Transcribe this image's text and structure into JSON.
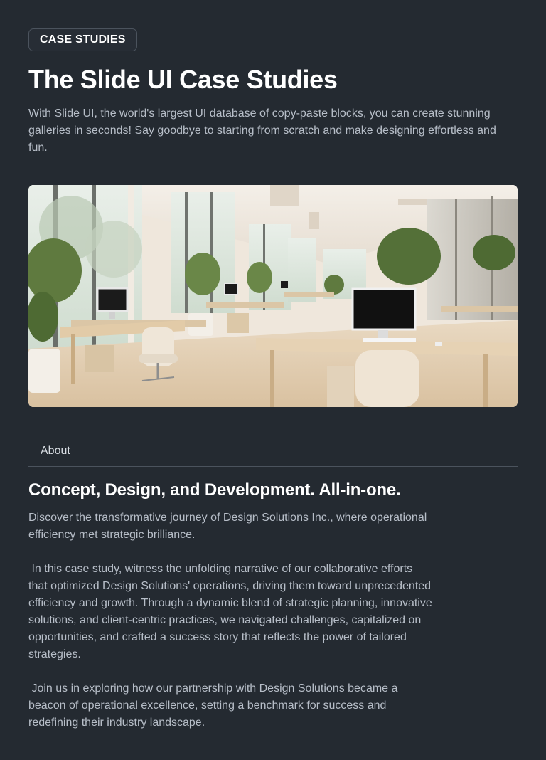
{
  "badge": {
    "label": "CASE STUDIES"
  },
  "header": {
    "title": "The Slide UI Case Studies",
    "intro": "With Slide UI, the world's largest UI database of copy-paste blocks, you can create stunning galleries in seconds! Say goodbye to starting from scratch and make designing effortless and fun."
  },
  "hero_image": {
    "subject": "bright open-plan office interior with desks, chairs, monitors and plants"
  },
  "tabs": [
    {
      "label": "About"
    }
  ],
  "content": {
    "heading": "Concept, Design, and Development. All-in-one.",
    "paragraphs": [
      "Discover the transformative journey of Design Solutions Inc., where operational efficiency met strategic brilliance.",
      " In this case study, witness the unfolding narrative of our collaborative efforts that optimized Design Solutions' operations, driving them toward unprecedented efficiency and growth. Through a dynamic blend of strategic planning, innovative solutions, and client-centric practices, we navigated challenges, capitalized on opportunities, and crafted a success story that reflects the power of tailored strategies.",
      " Join us in exploring how our partnership with Design Solutions became a beacon of operational excellence, setting a benchmark for success and redefining their industry landscape."
    ]
  },
  "colors": {
    "background": "#242a31",
    "text_primary": "#ffffff",
    "text_muted": "#b7bec8",
    "border": "#4b535d"
  }
}
